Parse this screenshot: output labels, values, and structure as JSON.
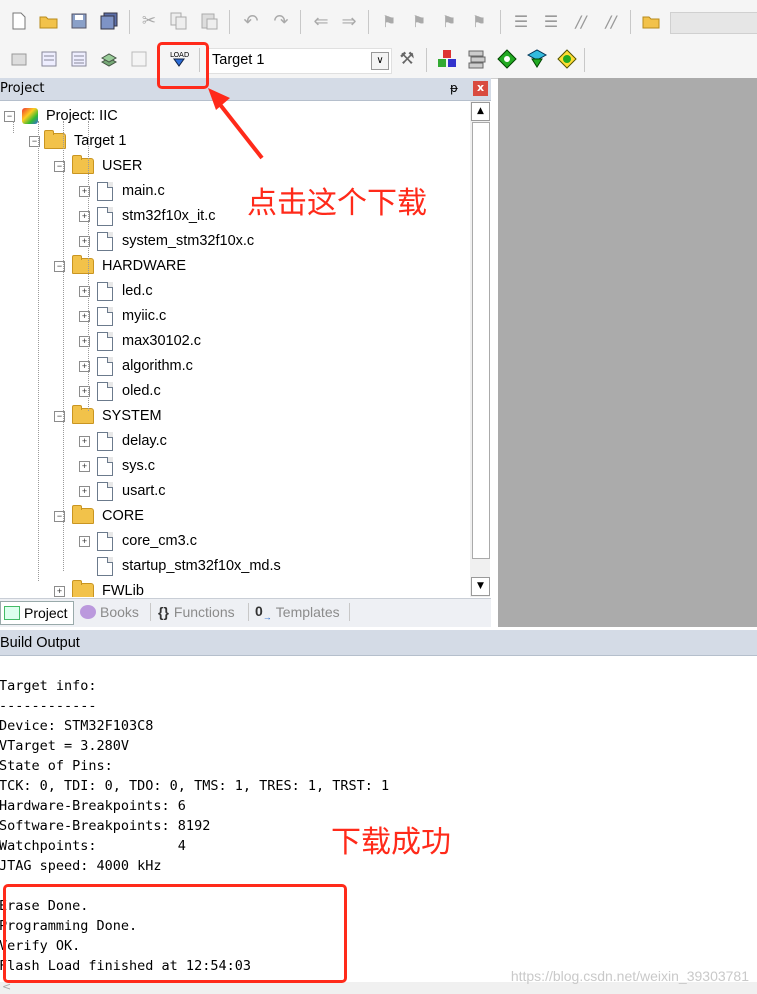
{
  "toolbar2": {
    "target_select": "Target 1",
    "load_label": "LOAD"
  },
  "project_panel": {
    "title": "Project",
    "pin_glyph": "ᵽ",
    "close_glyph": "x",
    "tree": [
      {
        "label": "Project: IIC",
        "level": 0,
        "kind": "project",
        "toggle": "−"
      },
      {
        "label": "Target 1",
        "level": 1,
        "kind": "target",
        "toggle": "−"
      },
      {
        "label": "USER",
        "level": 2,
        "kind": "folder",
        "toggle": "−"
      },
      {
        "label": "main.c",
        "level": 3,
        "kind": "file",
        "toggle": "+"
      },
      {
        "label": "stm32f10x_it.c",
        "level": 3,
        "kind": "file",
        "toggle": "+"
      },
      {
        "label": "system_stm32f10x.c",
        "level": 3,
        "kind": "file",
        "toggle": "+"
      },
      {
        "label": "HARDWARE",
        "level": 2,
        "kind": "folder",
        "toggle": "−"
      },
      {
        "label": "led.c",
        "level": 3,
        "kind": "file",
        "toggle": "+"
      },
      {
        "label": "myiic.c",
        "level": 3,
        "kind": "file",
        "toggle": "+"
      },
      {
        "label": "max30102.c",
        "level": 3,
        "kind": "file",
        "toggle": "+"
      },
      {
        "label": "algorithm.c",
        "level": 3,
        "kind": "file",
        "toggle": "+"
      },
      {
        "label": "oled.c",
        "level": 3,
        "kind": "file",
        "toggle": "+"
      },
      {
        "label": "SYSTEM",
        "level": 2,
        "kind": "folder",
        "toggle": "−"
      },
      {
        "label": "delay.c",
        "level": 3,
        "kind": "file",
        "toggle": "+"
      },
      {
        "label": "sys.c",
        "level": 3,
        "kind": "file",
        "toggle": "+"
      },
      {
        "label": "usart.c",
        "level": 3,
        "kind": "file",
        "toggle": "+"
      },
      {
        "label": "CORE",
        "level": 2,
        "kind": "folder",
        "toggle": "−"
      },
      {
        "label": "core_cm3.c",
        "level": 3,
        "kind": "file",
        "toggle": "+"
      },
      {
        "label": "startup_stm32f10x_md.s",
        "level": 3,
        "kind": "file",
        "toggle": ""
      },
      {
        "label": "FWLib",
        "level": 2,
        "kind": "folder",
        "toggle": "+"
      }
    ],
    "tabs": [
      "Project",
      "Books",
      "Functions",
      "Templates"
    ]
  },
  "build_output": {
    "title": "Build Output",
    "lines": [
      "Target info:",
      "------------",
      "Device: STM32F103C8",
      "VTarget = 3.280V",
      "State of Pins:",
      "TCK: 0, TDI: 0, TDO: 0, TMS: 1, TRES: 1, TRST: 1",
      "Hardware-Breakpoints: 6",
      "Software-Breakpoints: 8192",
      "Watchpoints:          4",
      "JTAG speed: 4000 kHz",
      "",
      "Erase Done.",
      "Programming Done.",
      "Verify OK.",
      "Flash Load finished at 12:54:03"
    ]
  },
  "annotations": {
    "download_note": "点击这个下载",
    "success_note": "下载成功"
  },
  "watermark": "https://blog.csdn.net/weixin_39303781",
  "colors": {
    "annotation_red": "#ff2a1a",
    "panel_header": "#d4dbe6",
    "editor_gray": "#ababab"
  }
}
